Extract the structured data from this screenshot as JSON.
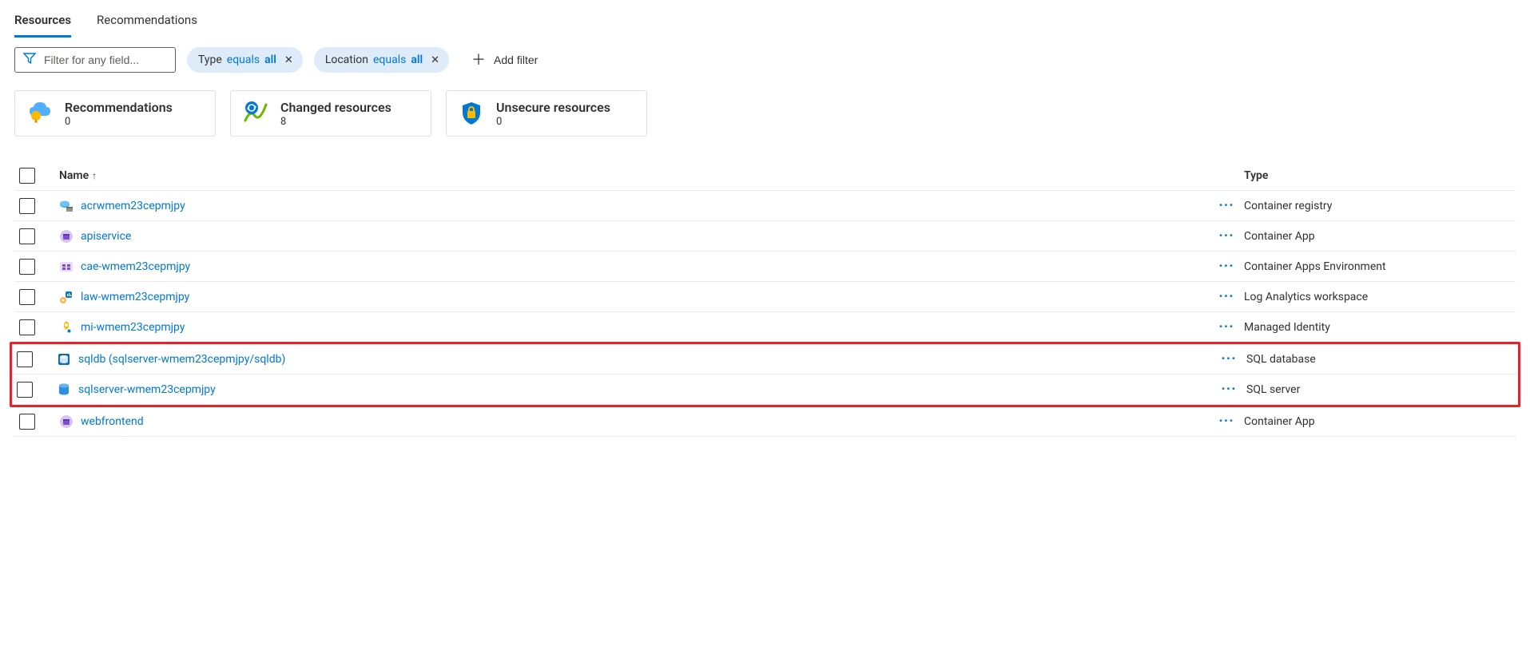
{
  "tabs": [
    {
      "label": "Resources",
      "active": true
    },
    {
      "label": "Recommendations",
      "active": false
    }
  ],
  "filter": {
    "placeholder": "Filter for any field...",
    "pills": [
      {
        "field": "Type",
        "op": "equals",
        "val": "all"
      },
      {
        "field": "Location",
        "op": "equals",
        "val": "all"
      }
    ],
    "add_label": "Add filter"
  },
  "cards": [
    {
      "icon": "recommend",
      "title": "Recommendations",
      "count": "0"
    },
    {
      "icon": "changed",
      "title": "Changed resources",
      "count": "8"
    },
    {
      "icon": "unsecure",
      "title": "Unsecure resources",
      "count": "0"
    }
  ],
  "columns": {
    "name": "Name",
    "type": "Type"
  },
  "more_glyph": "···",
  "rows": [
    {
      "icon": "acr",
      "name": "acrwmem23cepmjpy",
      "type": "Container registry",
      "hl": false
    },
    {
      "icon": "capp",
      "name": "apiservice",
      "type": "Container App",
      "hl": false
    },
    {
      "icon": "cae",
      "name": "cae-wmem23cepmjpy",
      "type": "Container Apps Environment",
      "hl": false
    },
    {
      "icon": "law",
      "name": "law-wmem23cepmjpy",
      "type": "Log Analytics workspace",
      "hl": false
    },
    {
      "icon": "mi",
      "name": "mi-wmem23cepmjpy",
      "type": "Managed Identity",
      "hl": false
    },
    {
      "icon": "sqldb",
      "name": "sqldb (sqlserver-wmem23cepmjpy/sqldb)",
      "type": "SQL database",
      "hl": true
    },
    {
      "icon": "sqlsrv",
      "name": "sqlserver-wmem23cepmjpy",
      "type": "SQL server",
      "hl": true
    },
    {
      "icon": "capp",
      "name": "webfrontend",
      "type": "Container App",
      "hl": false
    }
  ]
}
